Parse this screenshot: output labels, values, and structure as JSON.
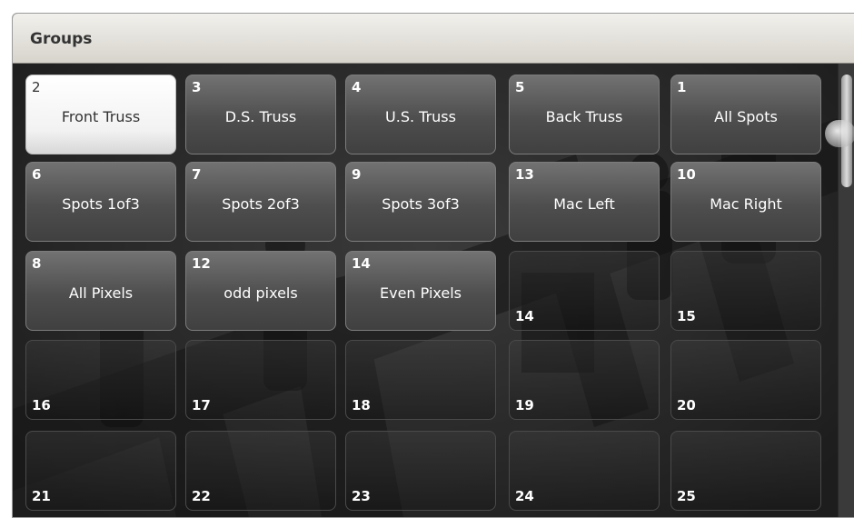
{
  "window": {
    "title": "Groups"
  },
  "tiles": [
    {
      "num": "2",
      "name": "Front Truss",
      "state": "selected"
    },
    {
      "num": "3",
      "name": "D.S. Truss",
      "state": "filled"
    },
    {
      "num": "4",
      "name": "U.S. Truss",
      "state": "filled"
    },
    {
      "num": "5",
      "name": "Back Truss",
      "state": "filled"
    },
    {
      "num": "1",
      "name": "All Spots",
      "state": "filled"
    },
    {
      "num": "6",
      "name": "Spots 1of3",
      "state": "filled"
    },
    {
      "num": "7",
      "name": "Spots 2of3",
      "state": "filled"
    },
    {
      "num": "9",
      "name": "Spots 3of3",
      "state": "filled"
    },
    {
      "num": "13",
      "name": "Mac Left",
      "state": "filled"
    },
    {
      "num": "10",
      "name": "Mac Right",
      "state": "filled"
    },
    {
      "num": "8",
      "name": "All Pixels",
      "state": "filled"
    },
    {
      "num": "12",
      "name": "odd pixels",
      "state": "filled"
    },
    {
      "num": "14",
      "name": "Even Pixels",
      "state": "filled"
    },
    {
      "num": "14",
      "name": "",
      "state": "empty"
    },
    {
      "num": "15",
      "name": "",
      "state": "empty"
    },
    {
      "num": "16",
      "name": "",
      "state": "empty"
    },
    {
      "num": "17",
      "name": "",
      "state": "empty"
    },
    {
      "num": "18",
      "name": "",
      "state": "empty"
    },
    {
      "num": "19",
      "name": "",
      "state": "empty"
    },
    {
      "num": "20",
      "name": "",
      "state": "empty"
    },
    {
      "num": "21",
      "name": "",
      "state": "empty"
    },
    {
      "num": "22",
      "name": "",
      "state": "empty"
    },
    {
      "num": "23",
      "name": "",
      "state": "empty"
    },
    {
      "num": "24",
      "name": "",
      "state": "empty"
    },
    {
      "num": "25",
      "name": "",
      "state": "empty"
    }
  ],
  "icons": {
    "scroll_handle": "scroll-grip-icon"
  }
}
